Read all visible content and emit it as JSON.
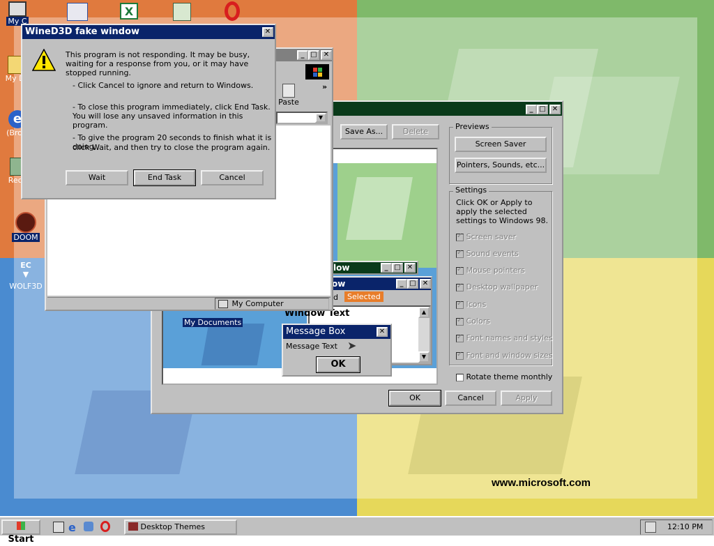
{
  "desktop": {
    "icons": [
      {
        "label": "My C",
        "icon": "computer-icon"
      },
      {
        "label": "My Do",
        "icon": "documents-icon"
      },
      {
        "label": "(Brow",
        "icon": "internet-explorer-icon"
      },
      {
        "label": "Recy",
        "icon": "recycle-bin-icon"
      },
      {
        "label": "DOOM",
        "icon": "doom-icon"
      },
      {
        "label": "WOLF3D",
        "icon": "wolf3d-icon"
      }
    ],
    "watermark": "www.microsoft.com"
  },
  "hung_dialog": {
    "title": "WineD3D fake window",
    "message": "This program is not responding. It may be busy, waiting for a response from you, or it may have stopped running.",
    "bullet1": "-  Click Cancel to ignore and return to Windows.",
    "bullet2a": "-  To close this program immediately, click End Task.",
    "bullet2b": "You will lose any unsaved information in this program.",
    "bullet3a": "-  To give the program 20 seconds to finish what it is doing,",
    "bullet3b": "click Wait, and then try to close the program again.",
    "wait": "Wait",
    "end_task": "End Task",
    "cancel": "Cancel"
  },
  "explorer": {
    "toolbar_paste": "Paste",
    "more": "»",
    "status": "My Computer"
  },
  "themes": {
    "save_as": "Save As...",
    "delete": "Delete",
    "previews_label": "Previews",
    "screen_saver": "Screen Saver",
    "pointers": "Pointers, Sounds, etc...",
    "settings_label": "Settings",
    "settings_hint": "Click OK or Apply to apply the selected settings to Windows 98.",
    "settings": [
      "Screen saver",
      "Sound events",
      "Mouse pointers",
      "Desktop wallpaper",
      "Icons",
      "Colors",
      "Font names and styles",
      "Font and window sizes"
    ],
    "rotate": "Rotate theme monthly",
    "ok": "OK",
    "cancel": "Cancel",
    "apply": "Apply"
  },
  "preview": {
    "win1_title": "low",
    "win2_title": "ow",
    "menu_normal": "d",
    "menu_selected": "Selected",
    "window_text": "Window Text",
    "my_documents": "My Documents",
    "msgbox_title": "Message Box",
    "msgbox_text": "Message Text",
    "msgbox_ok": "OK"
  },
  "taskbar": {
    "start": "Start",
    "task": "Desktop Themes",
    "clock": "12:10 PM",
    "colors": {
      "title": "#0a246a",
      "teal": "#008080",
      "selected": "#e87d2a"
    }
  }
}
